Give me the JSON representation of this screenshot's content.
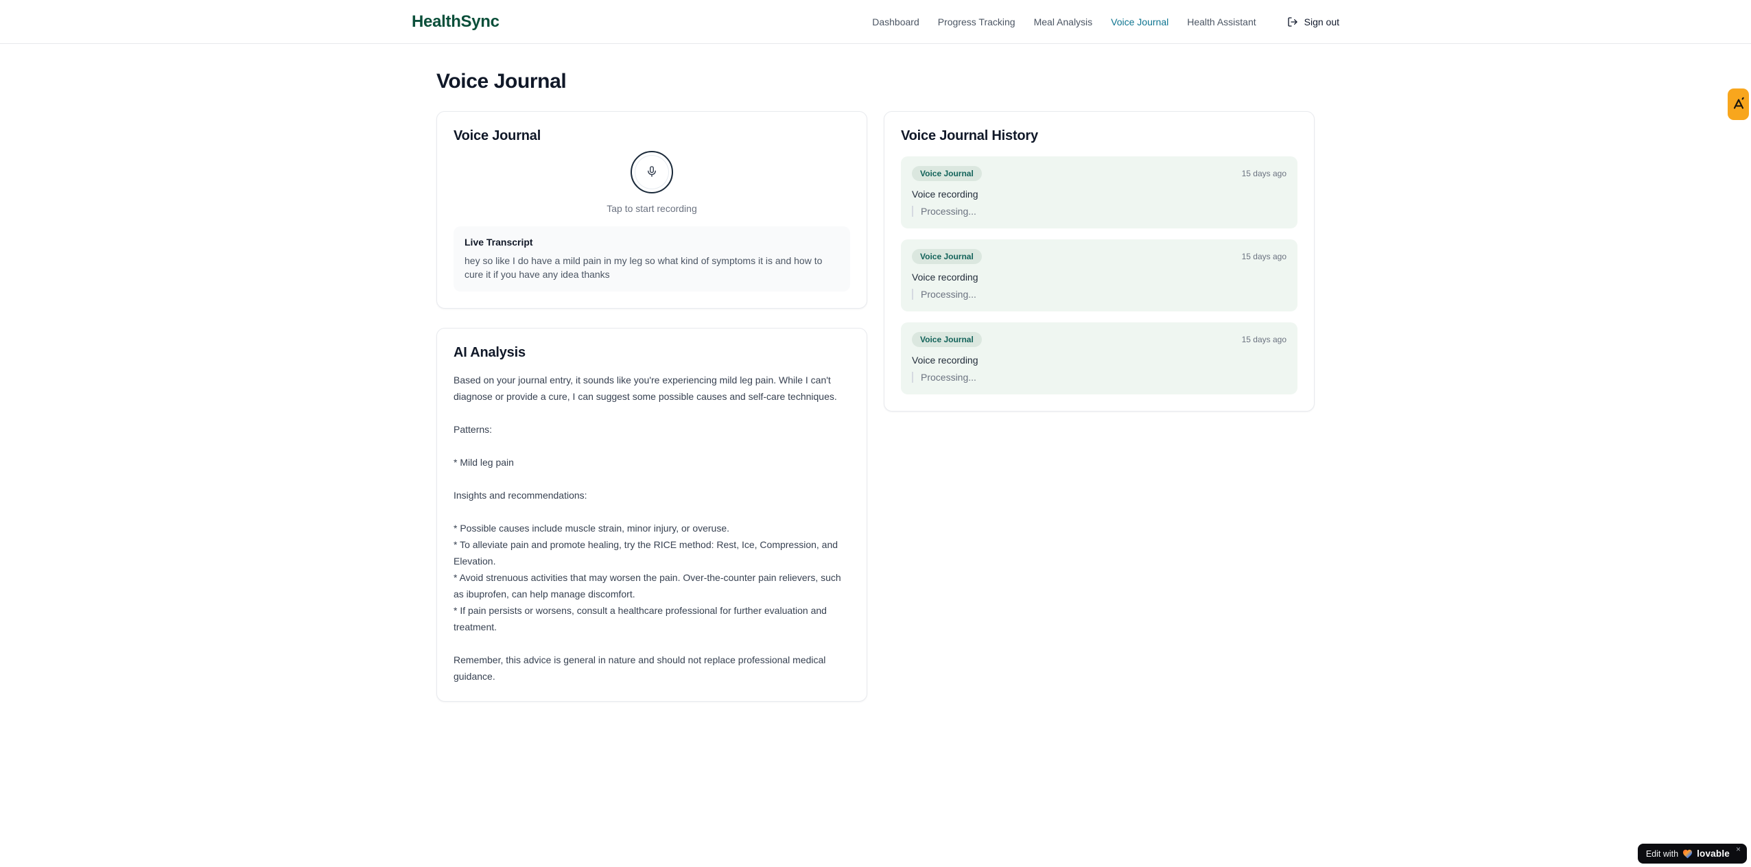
{
  "app": {
    "name": "HealthSync"
  },
  "nav": {
    "items": [
      {
        "label": "Dashboard",
        "active": false
      },
      {
        "label": "Progress Tracking",
        "active": false
      },
      {
        "label": "Meal Analysis",
        "active": false
      },
      {
        "label": "Voice Journal",
        "active": true
      },
      {
        "label": "Health Assistant",
        "active": false
      }
    ],
    "sign_out_label": "Sign out"
  },
  "page": {
    "title": "Voice Journal"
  },
  "recorder": {
    "card_title": "Voice Journal",
    "tap_hint": "Tap to start recording",
    "transcript_title": "Live Transcript",
    "transcript_text": "hey so like I do have a mild pain in my leg so what kind of symptoms it is and how to cure it if you have any idea thanks",
    "mic_icon": "mic-icon"
  },
  "analysis": {
    "card_title": "AI Analysis",
    "body": "Based on your journal entry, it sounds like you're experiencing mild leg pain. While I can't diagnose or provide a cure, I can suggest some possible causes and self-care techniques.\n\nPatterns:\n\n* Mild leg pain\n\nInsights and recommendations:\n\n* Possible causes include muscle strain, minor injury, or overuse.\n* To alleviate pain and promote healing, try the RICE method: Rest, Ice, Compression, and Elevation.\n* Avoid strenuous activities that may worsen the pain. Over-the-counter pain relievers, such as ibuprofen, can help manage discomfort.\n* If pain persists or worsens, consult a healthcare professional for further evaluation and treatment.\n\nRemember, this advice is general in nature and should not replace professional medical guidance."
  },
  "history": {
    "card_title": "Voice Journal History",
    "entries": [
      {
        "badge": "Voice Journal",
        "time": "15 days ago",
        "title": "Voice recording",
        "status": "Processing..."
      },
      {
        "badge": "Voice Journal",
        "time": "15 days ago",
        "title": "Voice recording",
        "status": "Processing..."
      },
      {
        "badge": "Voice Journal",
        "time": "15 days ago",
        "title": "Voice recording",
        "status": "Processing..."
      }
    ]
  },
  "overlay": {
    "edit_prefix": "Edit with",
    "brand": "lovable",
    "close_glyph": "×",
    "icons": {
      "heart": "heart-gradient-icon",
      "close": "close-icon",
      "launcher": "launcher-logo-icon",
      "sign_out": "logout-icon",
      "mic": "mic-icon"
    }
  },
  "colors": {
    "brand_green": "#0b4f3a",
    "nav_active_teal": "#0e7490",
    "history_entry_bg": "#eff6f1",
    "badge_bg": "#dbe7df",
    "badge_text": "#13635a",
    "launcher_orange": "#f8a61d",
    "lovable_badge_bg": "#0c0c10",
    "transcript_bg": "#f9fafb"
  }
}
